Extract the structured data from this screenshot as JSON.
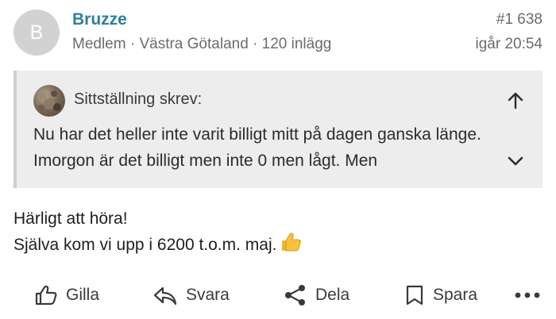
{
  "post": {
    "avatar_initial": "B",
    "username": "Bruzze",
    "meta": "Medlem · Västra Götaland · 120 inlägg",
    "number": "#1 638",
    "time": "igår 20:54"
  },
  "quote": {
    "author_line": "Sittställning skrev:",
    "text": "Nu har det heller inte varit billigt mitt på dagen ganska länge. Imorgon är det billigt men inte 0 men lågt. Men"
  },
  "body": {
    "line1": "Härligt att höra!",
    "line2": "Själva kom vi upp i 6200 t.o.m. maj."
  },
  "actions": {
    "like": "Gilla",
    "reply": "Svara",
    "share": "Dela",
    "save": "Spara"
  },
  "icons": {
    "expand_up": "arrow-up-icon",
    "expand_down": "chevron-down-icon",
    "like": "thumbs-up-outline-icon",
    "reply": "reply-arrow-icon",
    "share": "share-icon",
    "save": "bookmark-icon",
    "more": "more-dots-icon",
    "emoji": "thumbs-up-emoji"
  },
  "colors": {
    "username": "#2f7f9c",
    "quote_background": "#ededed",
    "meta_text": "#6b6b6b"
  }
}
